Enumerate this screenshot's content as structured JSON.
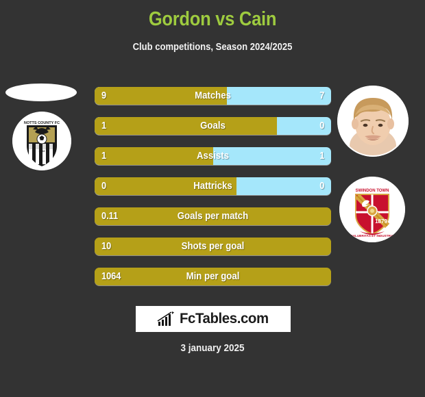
{
  "header": {
    "title": "Gordon vs Cain",
    "subtitle": "Club competitions, Season 2024/2025",
    "title_color": "#9ecb3f"
  },
  "colors": {
    "background": "#333333",
    "home_bar": "#b5a018",
    "away_bar": "#a5e7fb",
    "text": "#ffffff"
  },
  "media": {
    "home_photo": "player-photo-placeholder",
    "home_badge": "notts-county-crest",
    "away_photo": "player-photo-cain",
    "away_badge": "swindon-town-crest"
  },
  "stats": [
    {
      "label": "Matches",
      "home": "9",
      "away": "7",
      "home_pct": 56,
      "split": true
    },
    {
      "label": "Goals",
      "home": "1",
      "away": "0",
      "home_pct": 77,
      "split": true
    },
    {
      "label": "Assists",
      "home": "1",
      "away": "1",
      "home_pct": 50,
      "split": true
    },
    {
      "label": "Hattricks",
      "home": "0",
      "away": "0",
      "home_pct": 60,
      "split": true
    },
    {
      "label": "Goals per match",
      "home": "0.11",
      "away": "",
      "home_pct": 100,
      "split": false
    },
    {
      "label": "Shots per goal",
      "home": "10",
      "away": "",
      "home_pct": 100,
      "split": false
    },
    {
      "label": "Min per goal",
      "home": "1064",
      "away": "",
      "home_pct": 100,
      "split": false
    }
  ],
  "footer": {
    "logo_text": "FcTables.com",
    "logo_icon": "bar-chart-arrow-icon",
    "date": "3 january 2025"
  }
}
